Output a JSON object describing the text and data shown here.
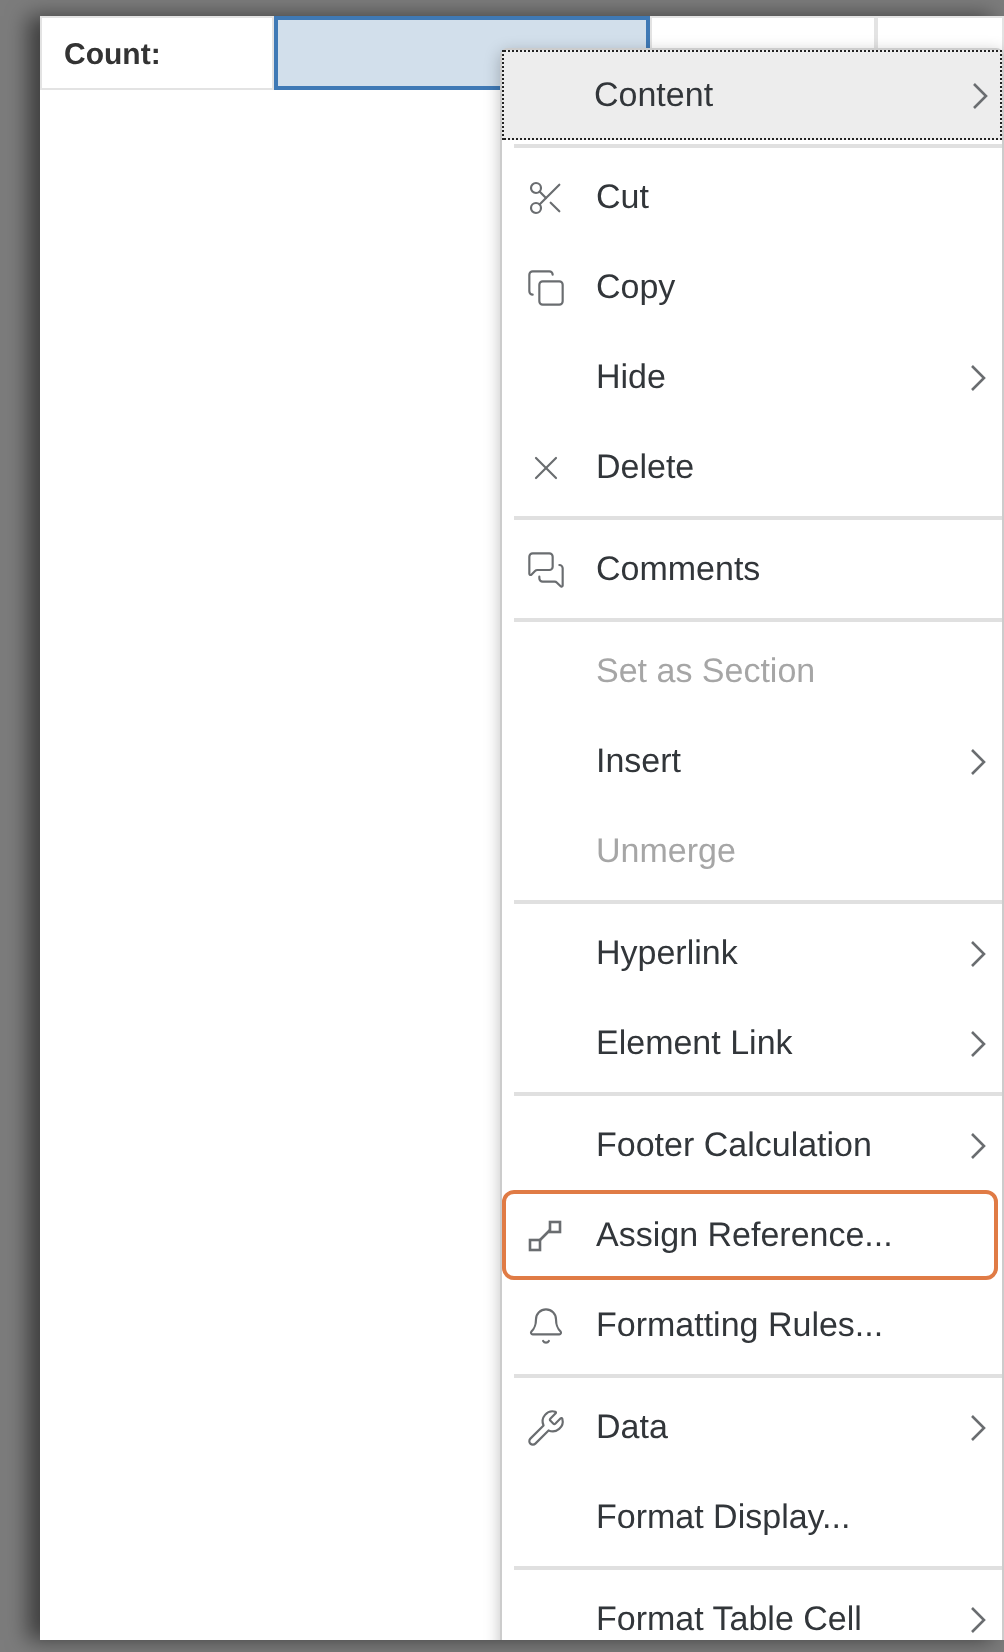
{
  "table": {
    "cells": [
      {
        "text": "Count:",
        "selected": false
      },
      {
        "selected": true
      },
      {
        "selected": false
      },
      {
        "selected": false
      }
    ]
  },
  "context_menu": {
    "items": [
      {
        "kind": "item",
        "label": "Content",
        "submenu": true,
        "disabled": false,
        "focused": true,
        "highlighted": false
      },
      {
        "kind": "separator"
      },
      {
        "kind": "item",
        "label": "Cut",
        "submenu": false,
        "disabled": false,
        "focused": false,
        "highlighted": false
      },
      {
        "kind": "item",
        "label": "Copy",
        "submenu": false,
        "disabled": false,
        "focused": false,
        "highlighted": false
      },
      {
        "kind": "item",
        "label": "Hide",
        "submenu": true,
        "disabled": false,
        "focused": false,
        "highlighted": false
      },
      {
        "kind": "item",
        "label": "Delete",
        "submenu": false,
        "disabled": false,
        "focused": false,
        "highlighted": false
      },
      {
        "kind": "separator"
      },
      {
        "kind": "item",
        "label": "Comments",
        "submenu": false,
        "disabled": false,
        "focused": false,
        "highlighted": false
      },
      {
        "kind": "separator"
      },
      {
        "kind": "item",
        "label": "Set as Section",
        "submenu": false,
        "disabled": true,
        "focused": false,
        "highlighted": false
      },
      {
        "kind": "item",
        "label": "Insert",
        "submenu": true,
        "disabled": false,
        "focused": false,
        "highlighted": false
      },
      {
        "kind": "item",
        "label": "Unmerge",
        "submenu": false,
        "disabled": true,
        "focused": false,
        "highlighted": false
      },
      {
        "kind": "separator"
      },
      {
        "kind": "item",
        "label": "Hyperlink",
        "submenu": true,
        "disabled": false,
        "focused": false,
        "highlighted": false
      },
      {
        "kind": "item",
        "label": "Element Link",
        "submenu": true,
        "disabled": false,
        "focused": false,
        "highlighted": false
      },
      {
        "kind": "separator"
      },
      {
        "kind": "item",
        "label": "Footer Calculation",
        "submenu": true,
        "disabled": false,
        "focused": false,
        "highlighted": false
      },
      {
        "kind": "item",
        "label": "Assign Reference...",
        "submenu": false,
        "disabled": false,
        "focused": false,
        "highlighted": true
      },
      {
        "kind": "item",
        "label": "Formatting Rules...",
        "submenu": false,
        "disabled": false,
        "focused": false,
        "highlighted": false
      },
      {
        "kind": "separator"
      },
      {
        "kind": "item",
        "label": "Data",
        "submenu": true,
        "disabled": false,
        "focused": false,
        "highlighted": false
      },
      {
        "kind": "item",
        "label": "Format Display...",
        "submenu": false,
        "disabled": false,
        "focused": false,
        "highlighted": false
      },
      {
        "kind": "separator"
      },
      {
        "kind": "item",
        "label": "Format Table Cell",
        "submenu": true,
        "disabled": false,
        "focused": false,
        "highlighted": false
      }
    ]
  }
}
